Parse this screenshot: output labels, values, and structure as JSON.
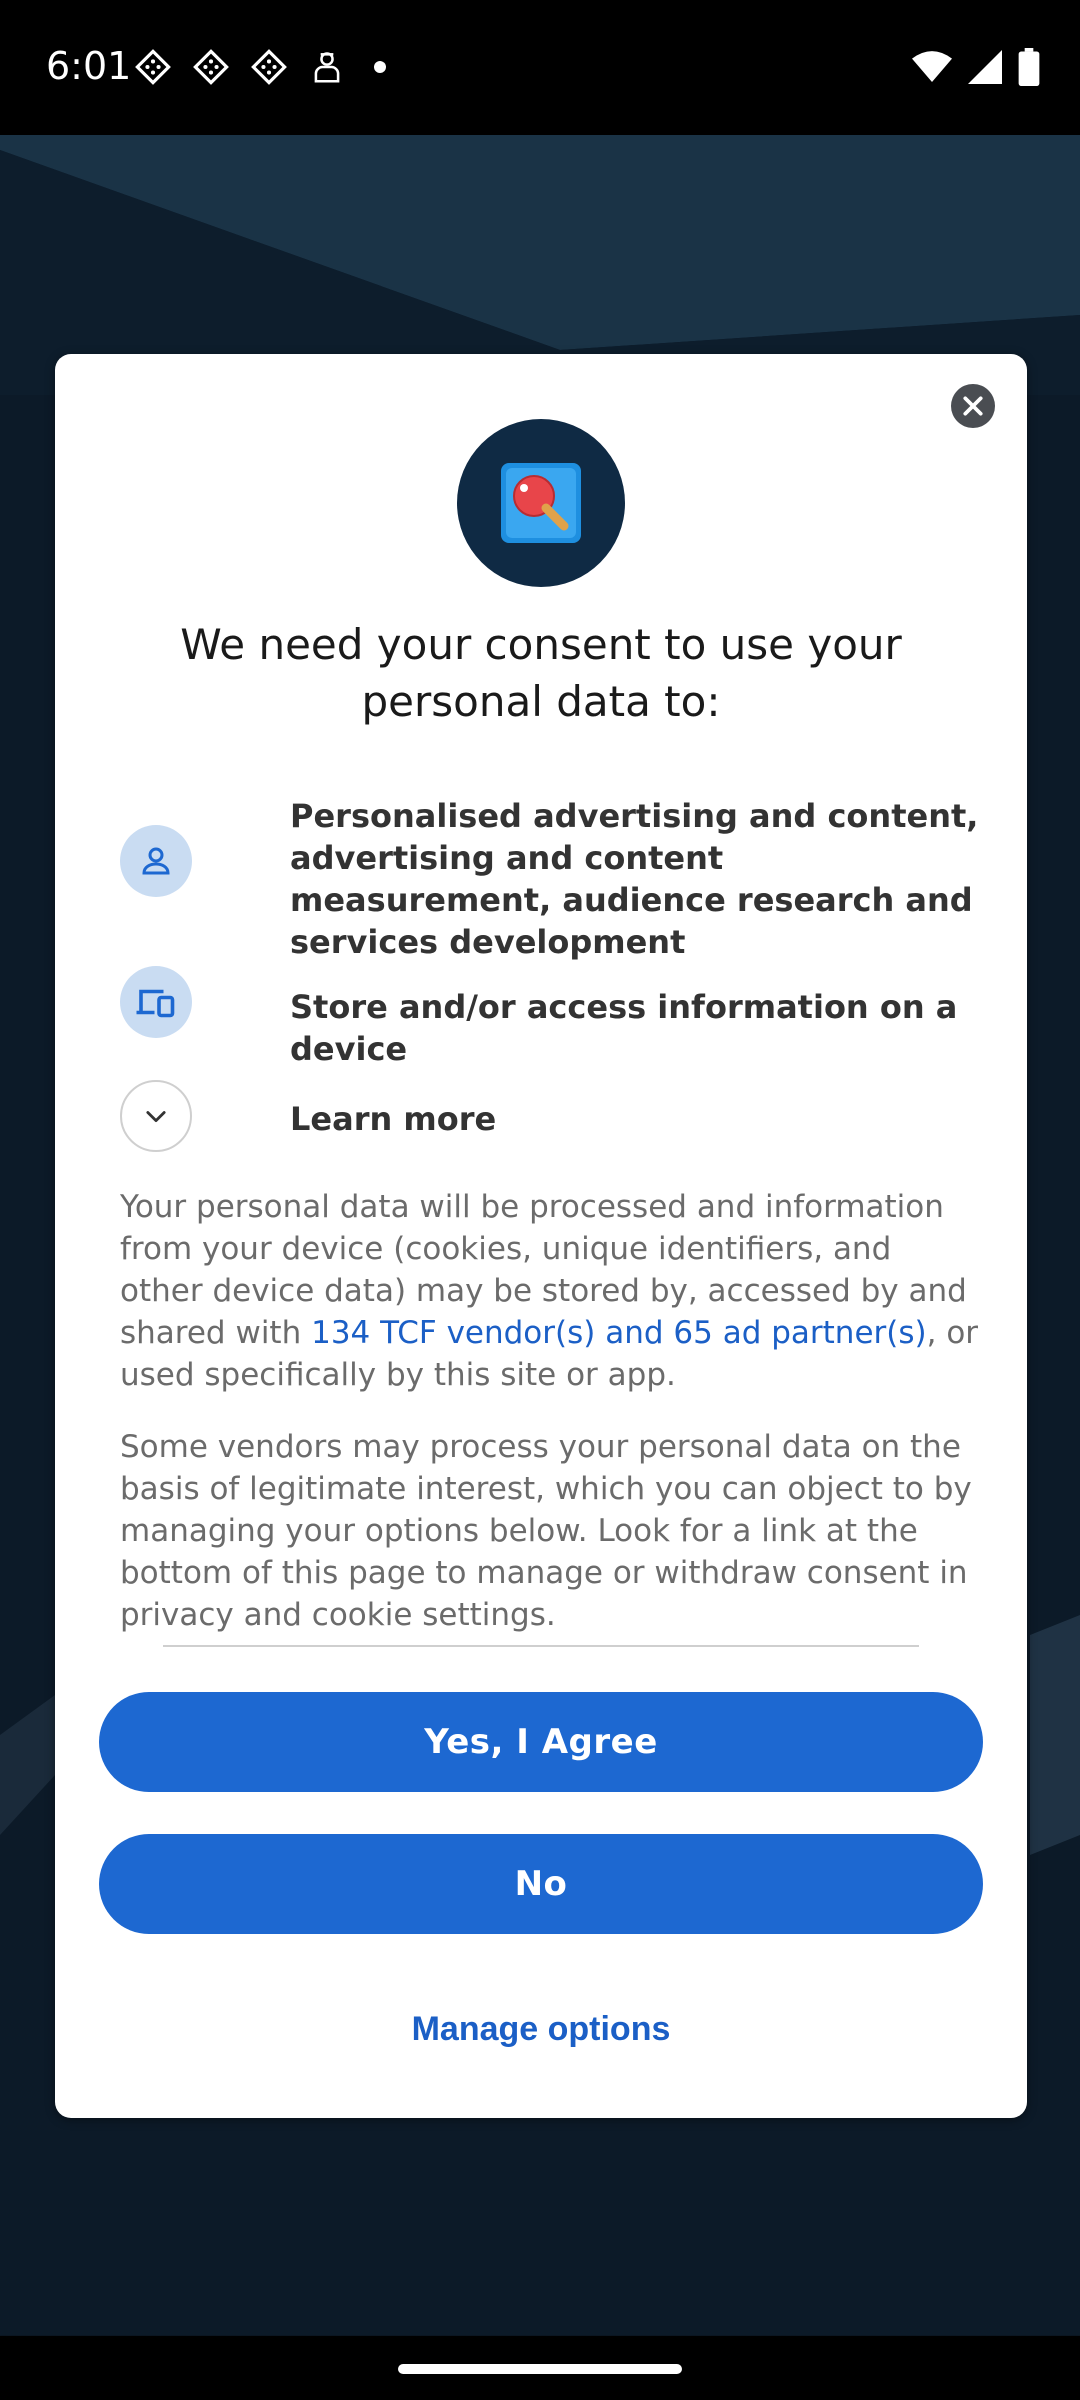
{
  "status_bar": {
    "time": "6:01",
    "notification_icons": [
      "app-notification-icon",
      "app-notification-icon",
      "app-notification-icon",
      "worker-app-icon"
    ],
    "right_icons": [
      "wifi-icon",
      "signal-icon",
      "battery-icon"
    ]
  },
  "dialog": {
    "title": "We need your consent to use your personal data to:",
    "purposes": [
      {
        "icon": "person-icon",
        "text": "Personalised advertising and content, advertising and content measurement, audience research and services development"
      },
      {
        "icon": "devices-icon",
        "text": "Store and/or access information on a device"
      }
    ],
    "learn_more": {
      "icon": "chevron-down-icon",
      "label": "Learn more"
    },
    "paragraph1": {
      "before_link": "Your personal data will be processed and information from your device (cookies, unique identifiers, and other device data) may be stored by, accessed by and shared with ",
      "link": "134 TCF vendor(s) and 65 ad partner(s)",
      "after_link": ", or used specifically by this site or app."
    },
    "paragraph2": "Some vendors may process your personal data on the basis of legitimate interest, which you can object to by managing your options below. Look for a link at the bottom of this page to manage or withdraw consent in privacy and cookie settings.",
    "agree_label": "Yes, I Agree",
    "no_label": "No",
    "manage_label": "Manage options"
  },
  "colors": {
    "accent": "#1d68d1",
    "link": "#1b5fc6",
    "icon_circle": "#c9dcf2",
    "logo_bg": "#0f2a44"
  }
}
